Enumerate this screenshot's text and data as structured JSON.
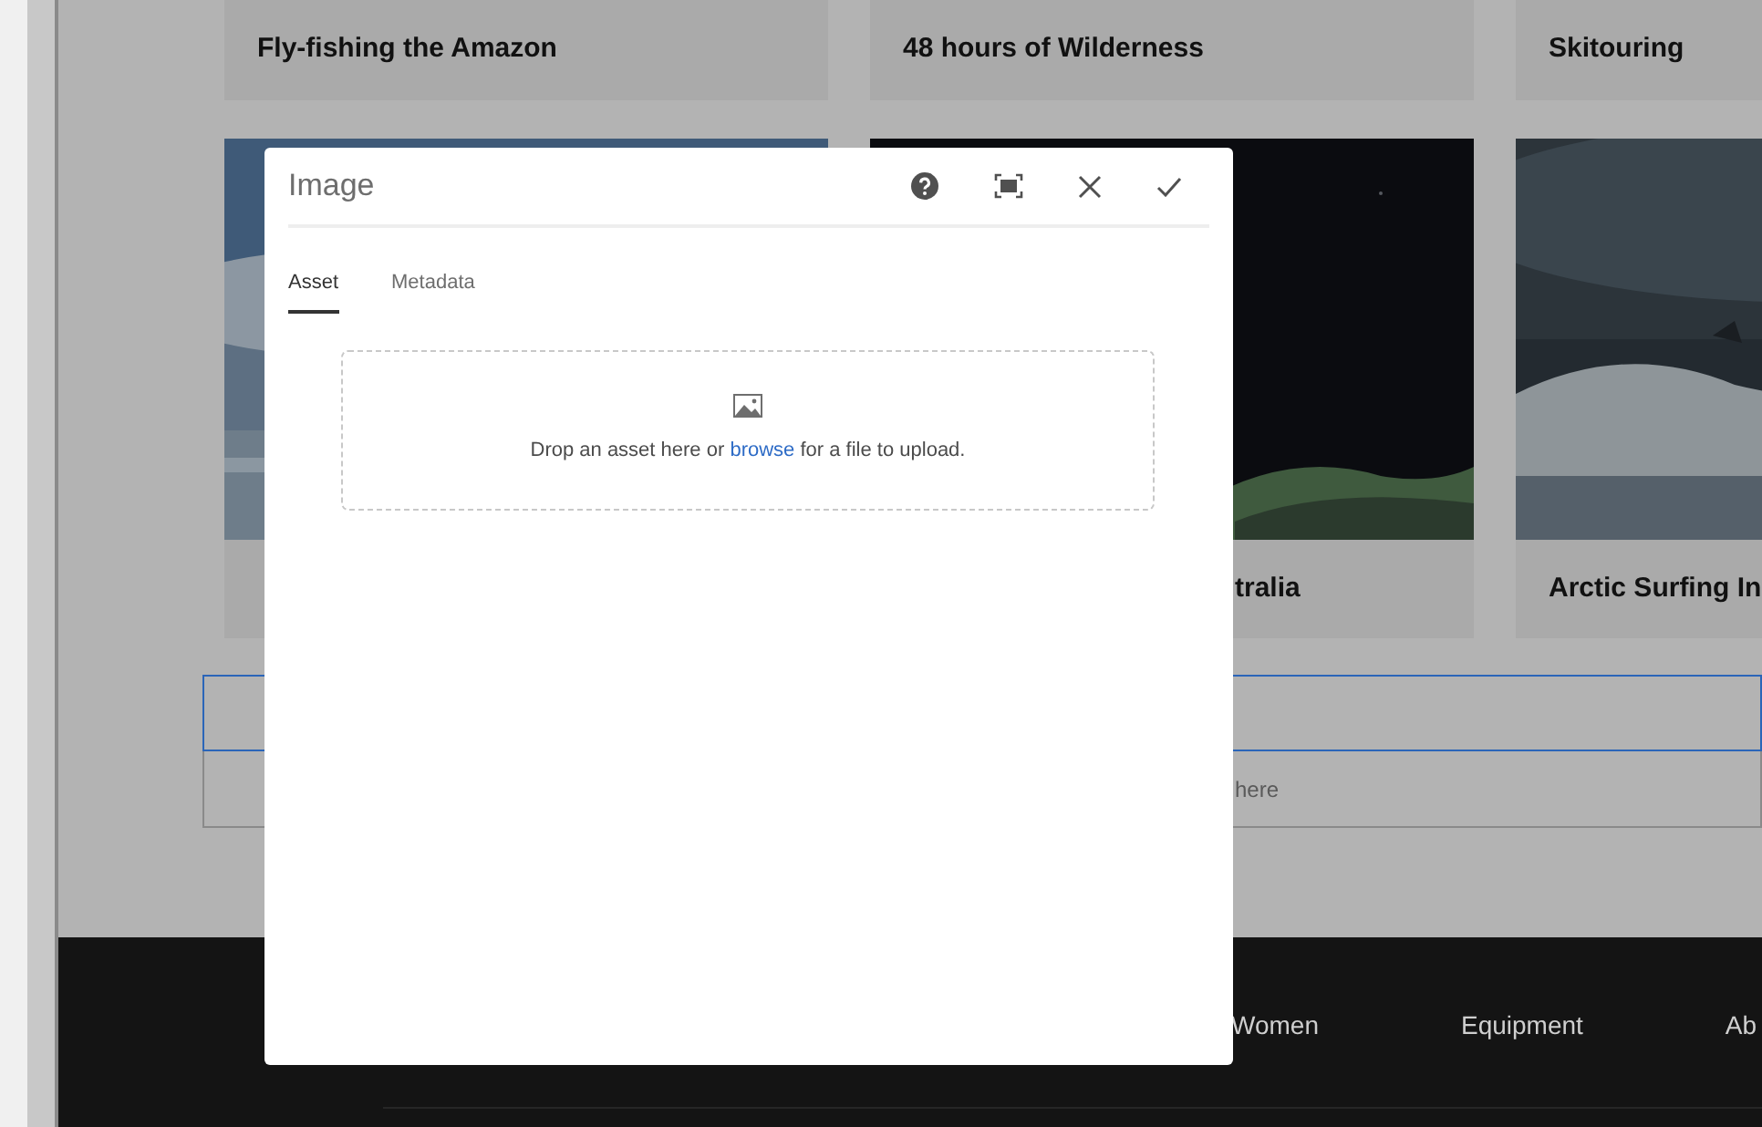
{
  "page": {
    "top_cards": [
      {
        "title": "Fly-fishing the Amazon"
      },
      {
        "title": "48 hours of Wilderness"
      },
      {
        "title": "Skitouring"
      }
    ],
    "cards": [
      {
        "kind": "picture"
      },
      {
        "kind": "picture",
        "title": "tralia"
      },
      {
        "kind": "picture",
        "title": "Arctic Surfing In"
      }
    ],
    "drop_hint": "here",
    "footer_nav": [
      "Women",
      "Equipment",
      "Ab"
    ]
  },
  "dialog": {
    "title": "Image",
    "tabs": [
      {
        "label": "Asset",
        "selected": true
      },
      {
        "label": "Metadata",
        "selected": false
      }
    ],
    "dropzone": {
      "before": "Drop an asset here or ",
      "link": "browse",
      "after": " for a file to upload."
    }
  }
}
